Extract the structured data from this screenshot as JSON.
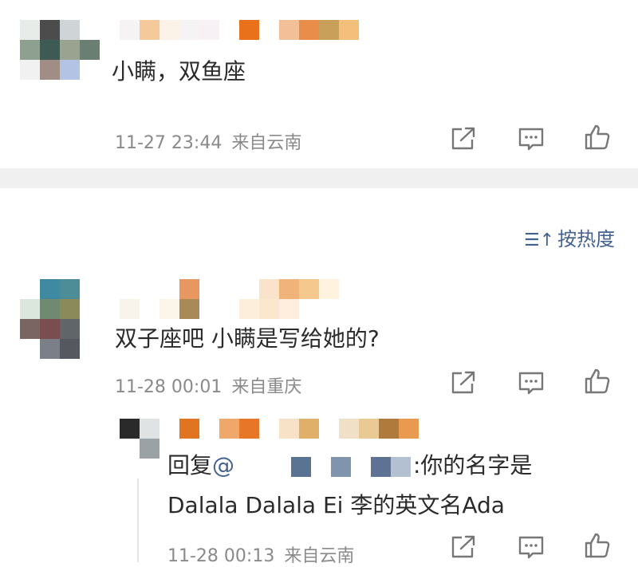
{
  "comments": [
    {
      "text": "小瞒，双鱼座",
      "time": "11-27 23:44",
      "location": "来自云南"
    },
    {
      "text": "双子座吧 小瞒是写给她的?",
      "time": "11-28 00:01",
      "location": "来自重庆"
    }
  ],
  "sort_label": "按热度",
  "reply": {
    "prefix": "回复",
    "mention": "@",
    "body_line1": ":你的名字是",
    "body_line2": "Dalala Dalala Ei 李的英文名Ada",
    "time": "11-28 00:13",
    "location": "来自云南"
  },
  "icons": {
    "share": "share-icon",
    "comment": "comment-icon",
    "like": "like-icon",
    "sort": "sort-icon"
  },
  "colors": {
    "link": "#44628e",
    "meta": "#8a8a8a",
    "icon": "#777777"
  }
}
